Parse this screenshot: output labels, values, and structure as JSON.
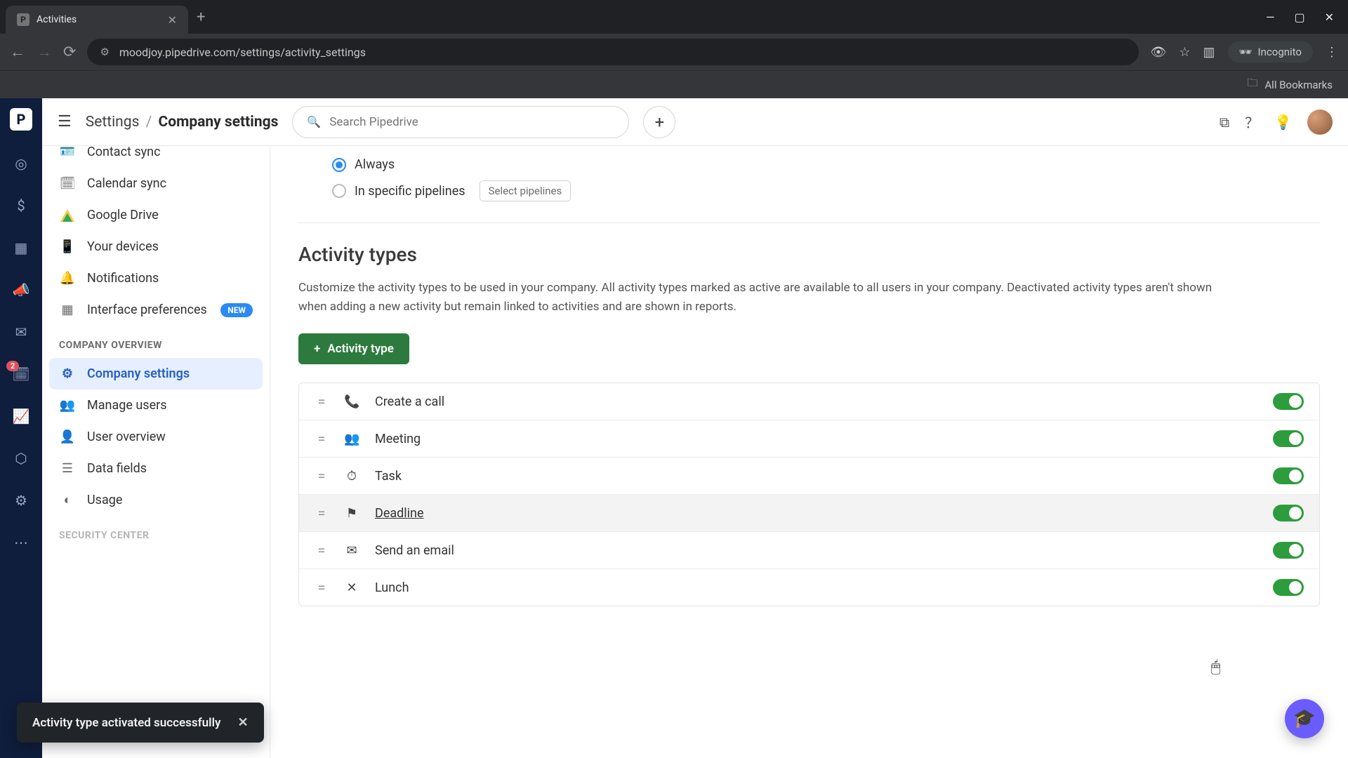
{
  "browser": {
    "tab_title": "Activities",
    "url": "moodjoy.pipedrive.com/settings/activity_settings",
    "incognito_label": "Incognito",
    "all_bookmarks": "All Bookmarks"
  },
  "rail": {
    "badge": "2"
  },
  "topbar": {
    "breadcrumb_root": "Settings",
    "breadcrumb_current": "Company settings",
    "search_placeholder": "Search Pipedrive"
  },
  "sidebar": {
    "items_top": [
      {
        "label": "Contact sync",
        "icon": "person-card"
      },
      {
        "label": "Calendar sync",
        "icon": "calendar"
      },
      {
        "label": "Google Drive",
        "icon": "gdrive"
      },
      {
        "label": "Your devices",
        "icon": "phone"
      },
      {
        "label": "Notifications",
        "icon": "bell"
      },
      {
        "label": "Interface preferences",
        "icon": "layout",
        "new": true
      }
    ],
    "heading1": "COMPANY OVERVIEW",
    "items_co": [
      {
        "label": "Company settings",
        "icon": "gear",
        "active": true
      },
      {
        "label": "Manage users",
        "icon": "users"
      },
      {
        "label": "User overview",
        "icon": "user"
      },
      {
        "label": "Data fields",
        "icon": "fields"
      },
      {
        "label": "Usage",
        "icon": "gauge"
      }
    ],
    "heading2": "SECURITY CENTER",
    "new_badge": "NEW"
  },
  "main": {
    "radio_always": "Always",
    "radio_specific": "In specific pipelines",
    "select_pipelines": "Select pipelines",
    "section_title": "Activity types",
    "section_desc": "Customize the activity types to be used in your company. All activity types marked as active are available to all users in your company. Deactivated activity types aren't shown when adding a new activity but remain linked to activities and are shown in reports.",
    "add_btn": "Activity type",
    "types": [
      {
        "label": "Create a call",
        "icon": "📞"
      },
      {
        "label": "Meeting",
        "icon": "👥"
      },
      {
        "label": "Task",
        "icon": "⏱"
      },
      {
        "label": "Deadline",
        "icon": "⚑",
        "hover": true
      },
      {
        "label": "Send an email",
        "icon": "✉"
      },
      {
        "label": "Lunch",
        "icon": "✕"
      }
    ]
  },
  "toast": {
    "message": "Activity type activated successfully"
  }
}
